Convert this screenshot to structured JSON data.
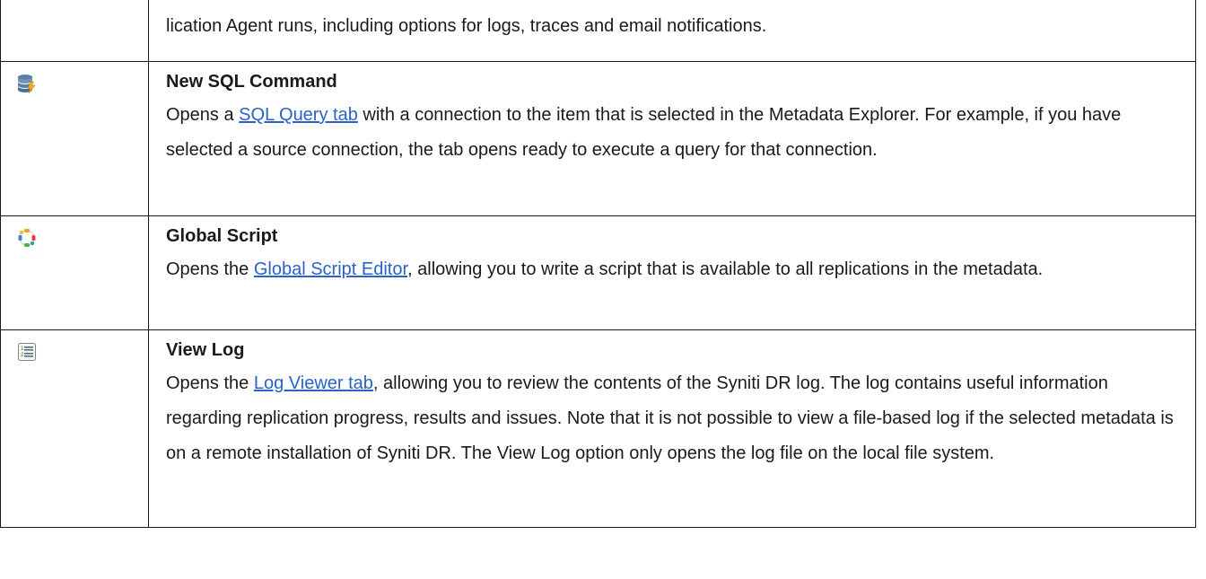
{
  "rows": [
    {
      "text": "lication Agent runs, including options for logs, traces and email notifications."
    },
    {
      "icon": "database-lightning-icon",
      "title": "New SQL Command",
      "desc_before": " Opens a ",
      "link": "SQL Query tab",
      "desc_after": " with a connection to the item that is selected in the Metadata Explorer. For example, if you have selected a source connection, the tab opens ready to execute a query for that connection."
    },
    {
      "icon": "global-script-icon",
      "title": "Global Script",
      "desc_before": " Opens the ",
      "link": "Global Script Editor",
      "desc_after": ", allowing you to write a script that is available to all replications in the metadata."
    },
    {
      "icon": "numbered-list-icon",
      "title": "View Log",
      "desc_before": " Opens the ",
      "link": "Log Viewer tab",
      "desc_after": ", allowing you to review the contents of the Syniti DR log. The log con­tains useful information regarding  replication progress, results and issues. Note that it is not pos­sible to view a file-based log if the selected metadata is on a remote installation of Syniti DR. The View Log option only opens the log file on the local file system."
    }
  ],
  "colors": {
    "link": "#2a62c9",
    "border": "#1a1a1a",
    "text": "#1a1a1a"
  }
}
